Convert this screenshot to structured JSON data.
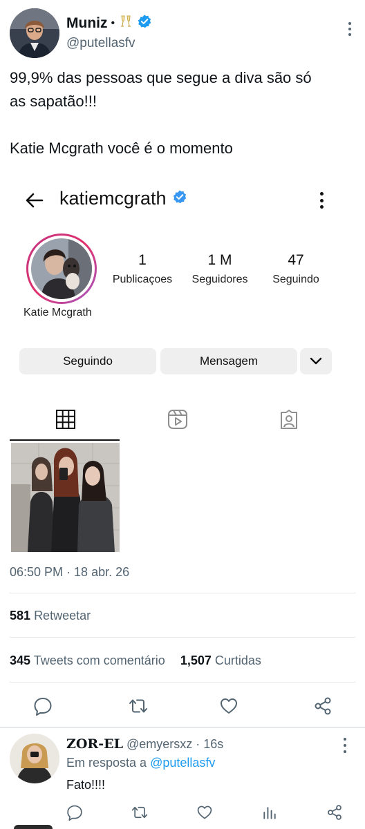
{
  "tweet": {
    "author_name": "Muniz",
    "author_separator": "•",
    "author_handle": "@putellasfv",
    "text_lines": [
      "99,9% das pessoas que segue a diva são só",
      "as sapatão!!!",
      "Katie Mcgrath você é o momento"
    ],
    "timestamp": "06:50 PM · 18 abr. 26",
    "retweets_count": "581",
    "retweets_label": "Retweetar",
    "quotes_count": "345",
    "quotes_label": "Tweets com comentário",
    "likes_count": "1,507",
    "likes_label": "Curtidas"
  },
  "instagram": {
    "username": "katiemcgrath",
    "full_name": "Katie Mcgrath",
    "stats": [
      {
        "value": "1",
        "label": "Publicaçoes"
      },
      {
        "value": "1 M",
        "label": "Seguidores"
      },
      {
        "value": "47",
        "label": "Seguindo"
      }
    ],
    "follow_button": "Seguindo",
    "message_button": "Mensagem"
  },
  "reply": {
    "author_name": "ZOR-EL",
    "author_handle": "@emyersxz",
    "time": "· 16s",
    "in_reply_label": "Em resposta a",
    "in_reply_handle": "@putellasfv",
    "text": "Fato!!!!"
  },
  "colors": {
    "text": "#0f1419",
    "secondary": "#536471",
    "accent": "#1d9bf0",
    "verified": "#1d9bf0",
    "divider": "#e6e9ec"
  },
  "icons": {
    "verified": "verified-badge-icon",
    "reply": "reply-icon",
    "retweet": "retweet-icon",
    "like": "heart-icon",
    "share": "share-icon",
    "views": "views-icon",
    "more": "more-vertical-icon"
  }
}
